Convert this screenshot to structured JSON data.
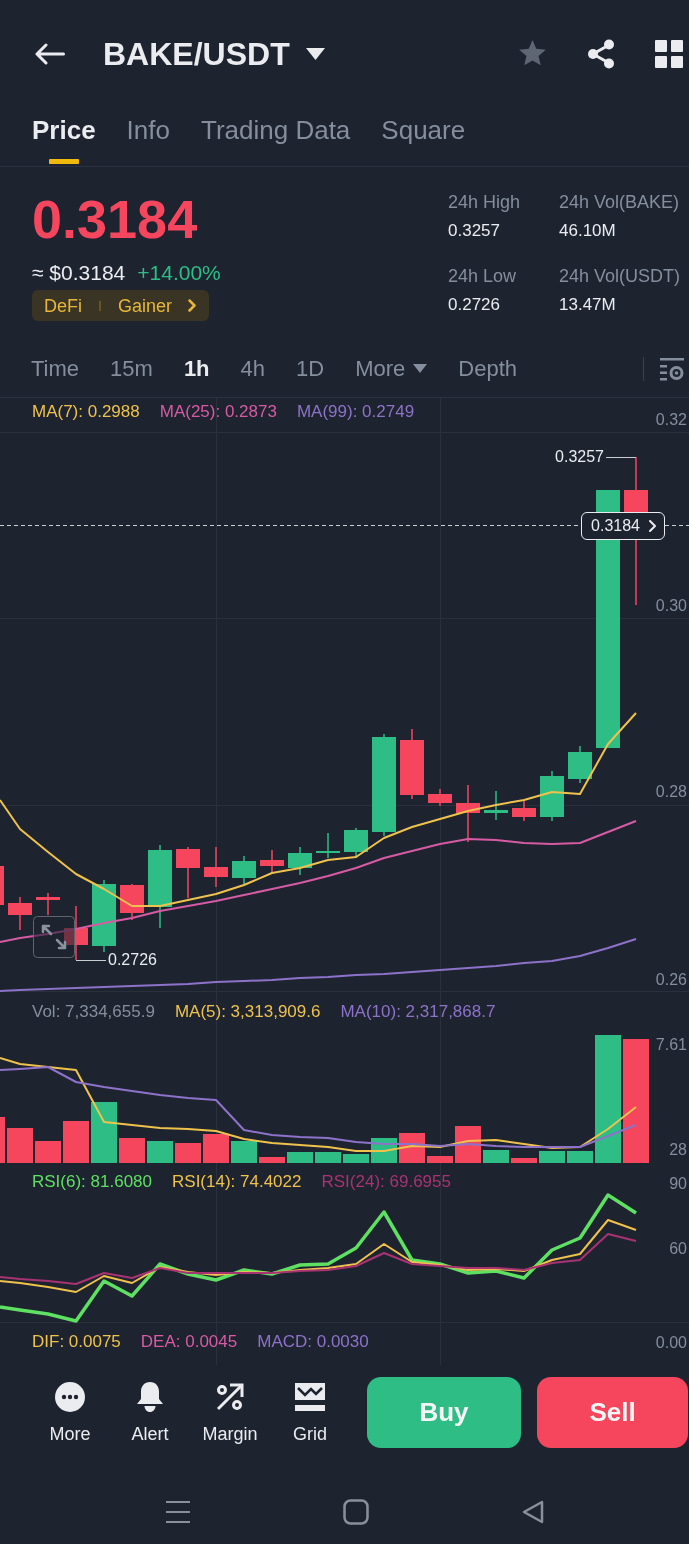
{
  "header": {
    "title": "BAKE/USDT"
  },
  "tabs": [
    {
      "label": "Price",
      "selected": true
    },
    {
      "label": "Info",
      "selected": false
    },
    {
      "label": "Trading Data",
      "selected": false
    },
    {
      "label": "Square",
      "selected": false
    }
  ],
  "ticker": {
    "price": "0.3184",
    "fiat_price": "≈ $0.3184",
    "change": "+14.00%",
    "tags": [
      "DeFi",
      "Gainer"
    ]
  },
  "stats": [
    {
      "label": "24h High",
      "value": "0.3257"
    },
    {
      "label": "24h Vol(BAKE)",
      "value": "46.10M"
    },
    {
      "label": "24h Low",
      "value": "0.2726"
    },
    {
      "label": "24h Vol(USDT)",
      "value": "13.47M"
    }
  ],
  "intervals": [
    {
      "label": "Time",
      "kind": "option",
      "selected": false
    },
    {
      "label": "15m",
      "kind": "option",
      "selected": false
    },
    {
      "label": "1h",
      "kind": "option",
      "selected": true
    },
    {
      "label": "4h",
      "kind": "option",
      "selected": false
    },
    {
      "label": "1D",
      "kind": "option",
      "selected": false
    },
    {
      "label": "More",
      "kind": "dropdown",
      "selected": false
    },
    {
      "label": "Depth",
      "kind": "option",
      "selected": false
    }
  ],
  "price_chart": {
    "legend": [
      {
        "text": "MA(7): 0.2988",
        "color": "#eec24c"
      },
      {
        "text": "MA(25): 0.2873",
        "color": "#d65ba4"
      },
      {
        "text": "MA(99): 0.2749",
        "color": "#8d72c9"
      }
    ],
    "axis_labels": [
      "0.32",
      "0.30",
      "0.28",
      "0.26"
    ],
    "high_label": "0.3257",
    "low_label": "0.2726",
    "last_price_tag": "0.3184"
  },
  "volume_chart": {
    "legend": [
      {
        "text": "Vol: 7,334,655.9",
        "color": "#848e9c"
      },
      {
        "text": "MA(5): 3,313,909.6",
        "color": "#eec24c"
      },
      {
        "text": "MA(10): 2,317,868.7",
        "color": "#8d72c9"
      }
    ],
    "axis_labels": [
      "7.61",
      "28"
    ]
  },
  "rsi_chart": {
    "legend": [
      {
        "text": "RSI(6): 81.6080",
        "color": "#5ee062"
      },
      {
        "text": "RSI(14): 74.4022",
        "color": "#eec24c"
      },
      {
        "text": "RSI(24): 69.6955",
        "color": "#a83372"
      }
    ],
    "axis_labels": [
      "90",
      "60"
    ]
  },
  "macd_chart": {
    "legend": [
      {
        "text": "DIF: 0.0075",
        "color": "#eec24c"
      },
      {
        "text": "DEA: 0.0045",
        "color": "#d65ba4"
      },
      {
        "text": "MACD: 0.0030",
        "color": "#8d72c9"
      }
    ],
    "axis_labels": [
      "0.00"
    ]
  },
  "actions": [
    {
      "label": "More"
    },
    {
      "label": "Alert"
    },
    {
      "label": "Margin"
    },
    {
      "label": "Grid"
    }
  ],
  "trade_buttons": [
    {
      "label": "Buy",
      "kind": "buy"
    },
    {
      "label": "Sell",
      "kind": "sell"
    }
  ]
}
